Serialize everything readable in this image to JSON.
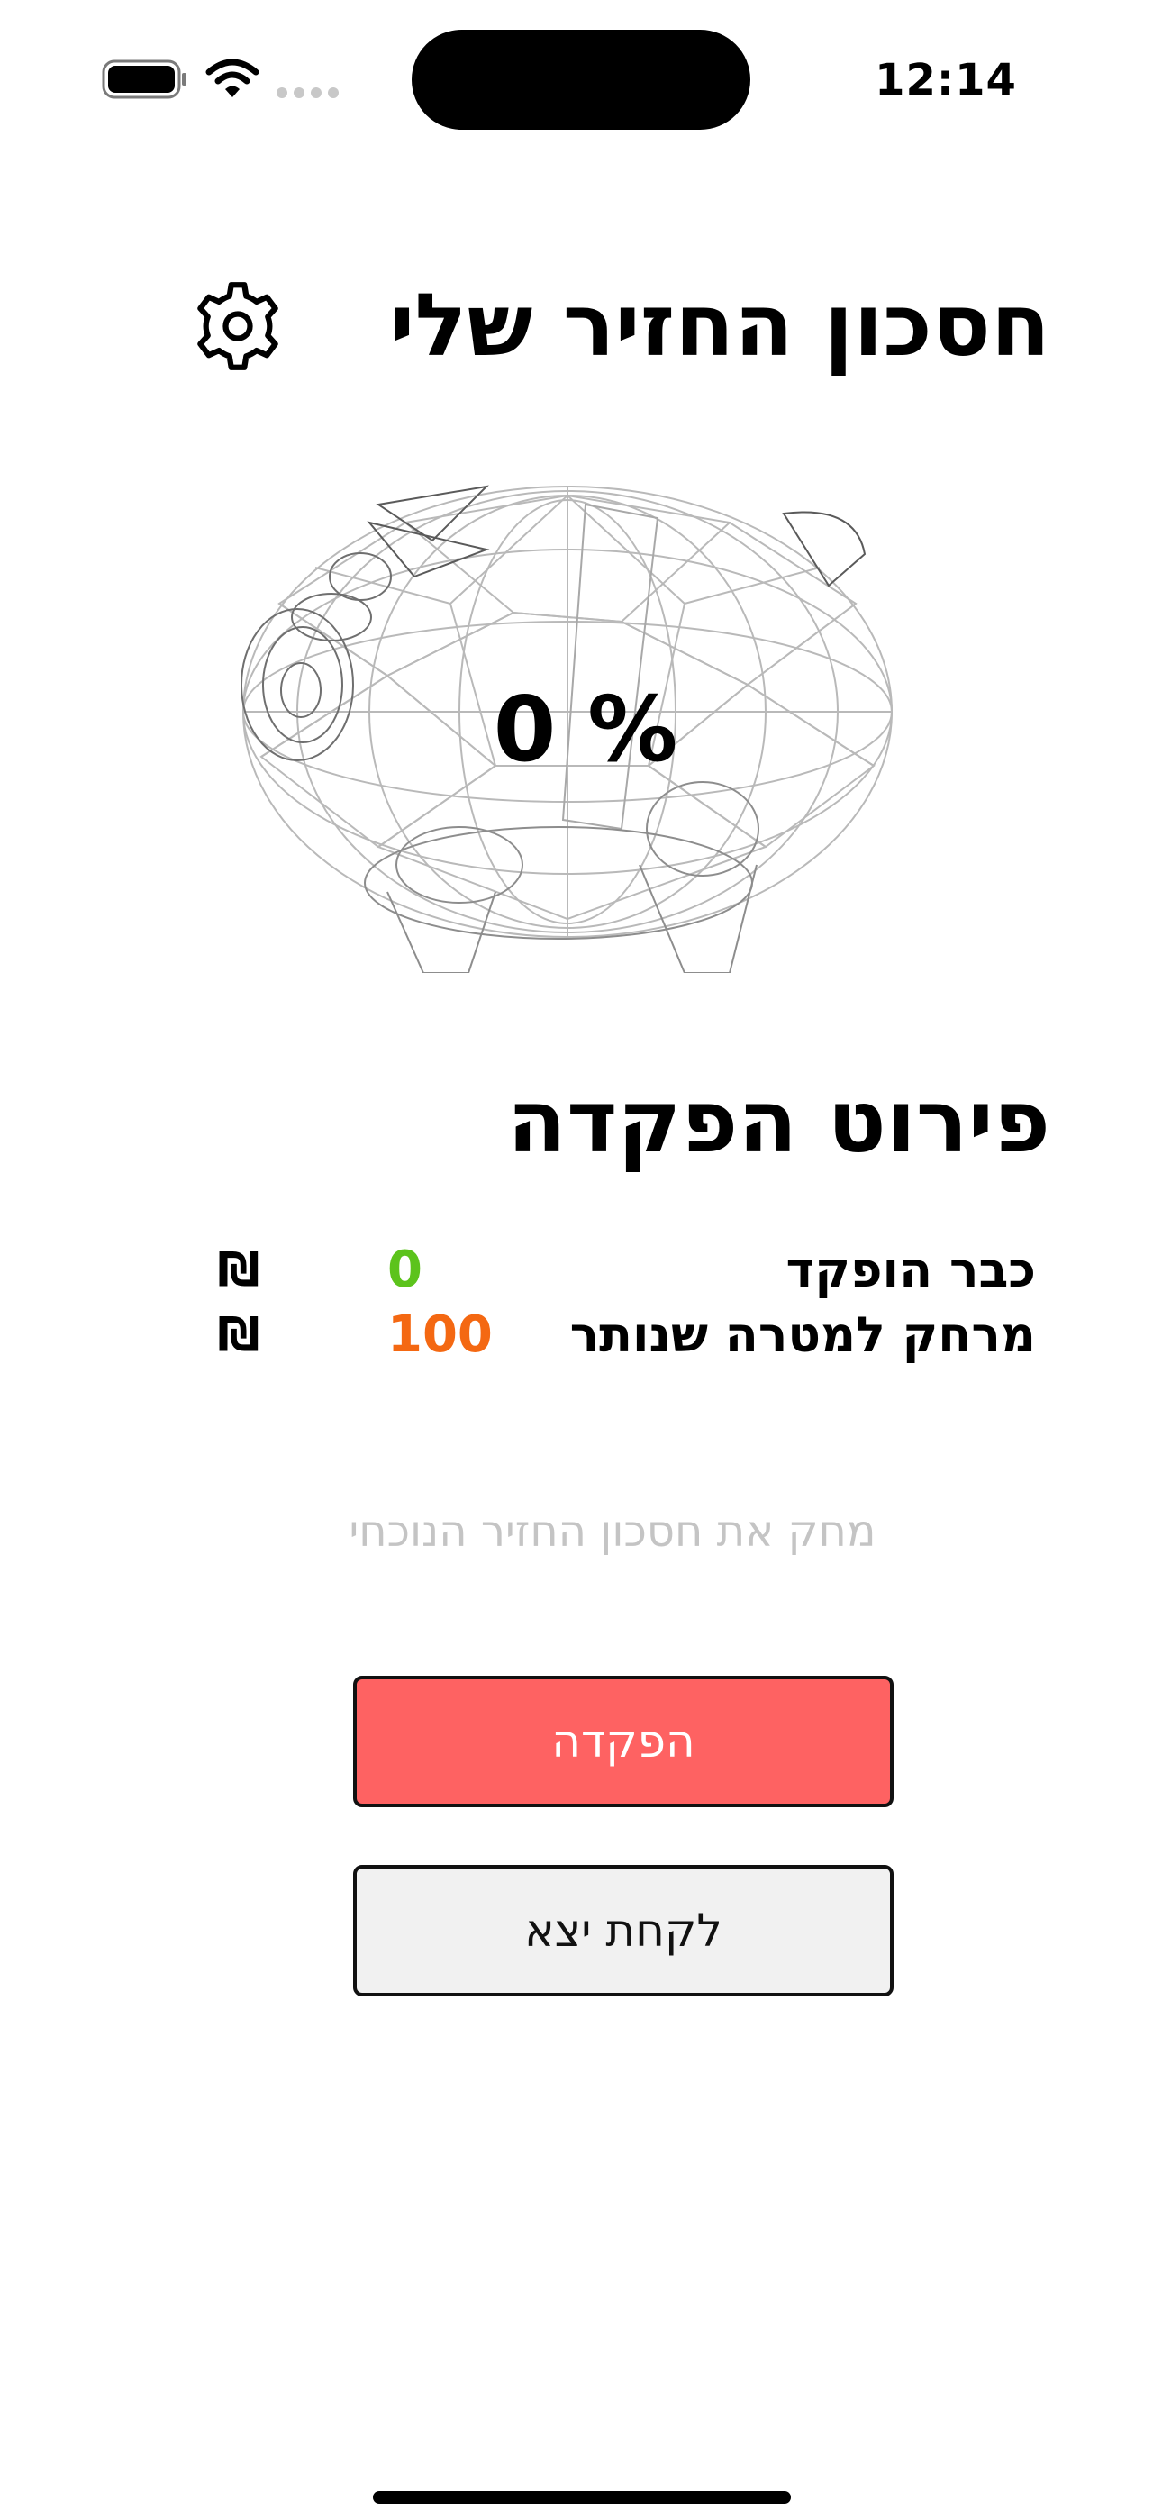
{
  "status_bar": {
    "time": "12:14",
    "icons": [
      "battery-icon",
      "wifi-icon",
      "cellular-signal-icon"
    ]
  },
  "header": {
    "title": "חסכון החזיר שלי",
    "settings_icon": "gear-icon"
  },
  "piggy": {
    "percent_label": "0 %",
    "image": "piggy-bank-wireframe"
  },
  "details": {
    "title": "פירוט הפקדה",
    "rows": [
      {
        "label": "כבר הופקד",
        "value": "0",
        "currency": "₪",
        "value_color": "#5cc31c"
      },
      {
        "label": "מרחק למטרה שנותר",
        "value": "100",
        "currency": "₪",
        "value_color": "#f46812"
      }
    ]
  },
  "delete_link": "מחק את חסכון החזיר הנוכחי",
  "buttons": {
    "deposit": "הפקדה",
    "withdraw": "לקחת יצא"
  },
  "colors": {
    "deposit_button_bg": "#fe6262",
    "withdraw_button_bg": "#f1f1f1",
    "delete_link_text": "#c4c4c4"
  }
}
